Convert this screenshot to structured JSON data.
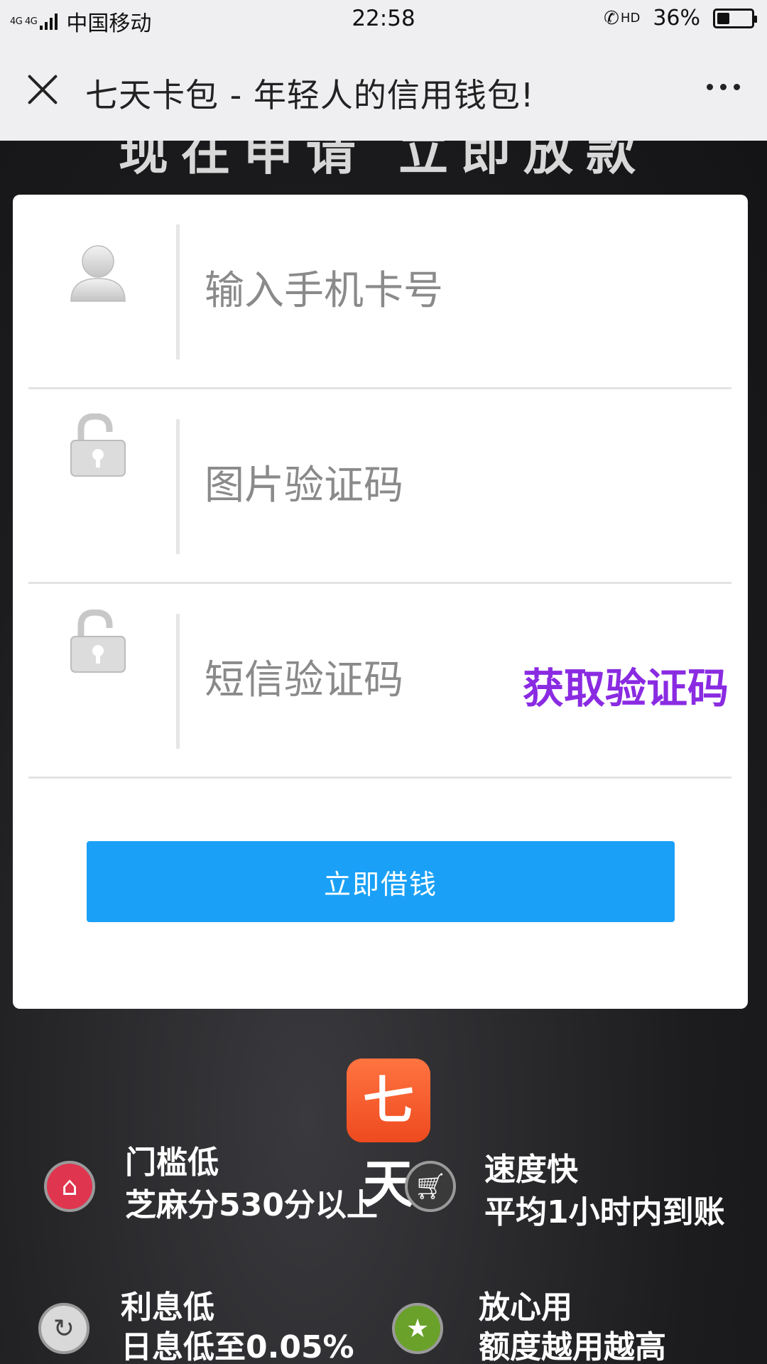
{
  "status_bar": {
    "network": "4G 4G",
    "carrier": "中国移动",
    "time": "22:58",
    "hd": "HD",
    "battery_percent": "36%",
    "battery_level": 0.36
  },
  "title_bar": {
    "title": "七天卡包 - 年轻人的信用钱包!"
  },
  "banner": {
    "slogan": "现在申请 立即放款"
  },
  "form": {
    "phone_placeholder": "输入手机卡号",
    "captcha_placeholder": "图片验证码",
    "sms_placeholder": "短信验证码",
    "get_code_label": "获取验证码",
    "submit_label": "立即借钱"
  },
  "logo": {
    "text": "七天"
  },
  "features": [
    {
      "title": "门槛低",
      "desc": "芝麻分530分以上",
      "icon": "home-icon",
      "color": "#e0354e"
    },
    {
      "title": "速度快",
      "desc": "平均1小时内到账",
      "icon": "cart-icon",
      "color": "#3a3a3a"
    },
    {
      "title": "利息低",
      "desc": "日息低至0.05%",
      "icon": "refresh-icon",
      "color": "#d9d9d9"
    },
    {
      "title": "放心用",
      "desc": "额度越用越高",
      "icon": "star-icon",
      "color": "#6aa12a"
    }
  ],
  "colors": {
    "accent_blue": "#1aa1f7",
    "get_code_purple": "#8a2be2",
    "logo_orange": "#ee4a1f"
  }
}
